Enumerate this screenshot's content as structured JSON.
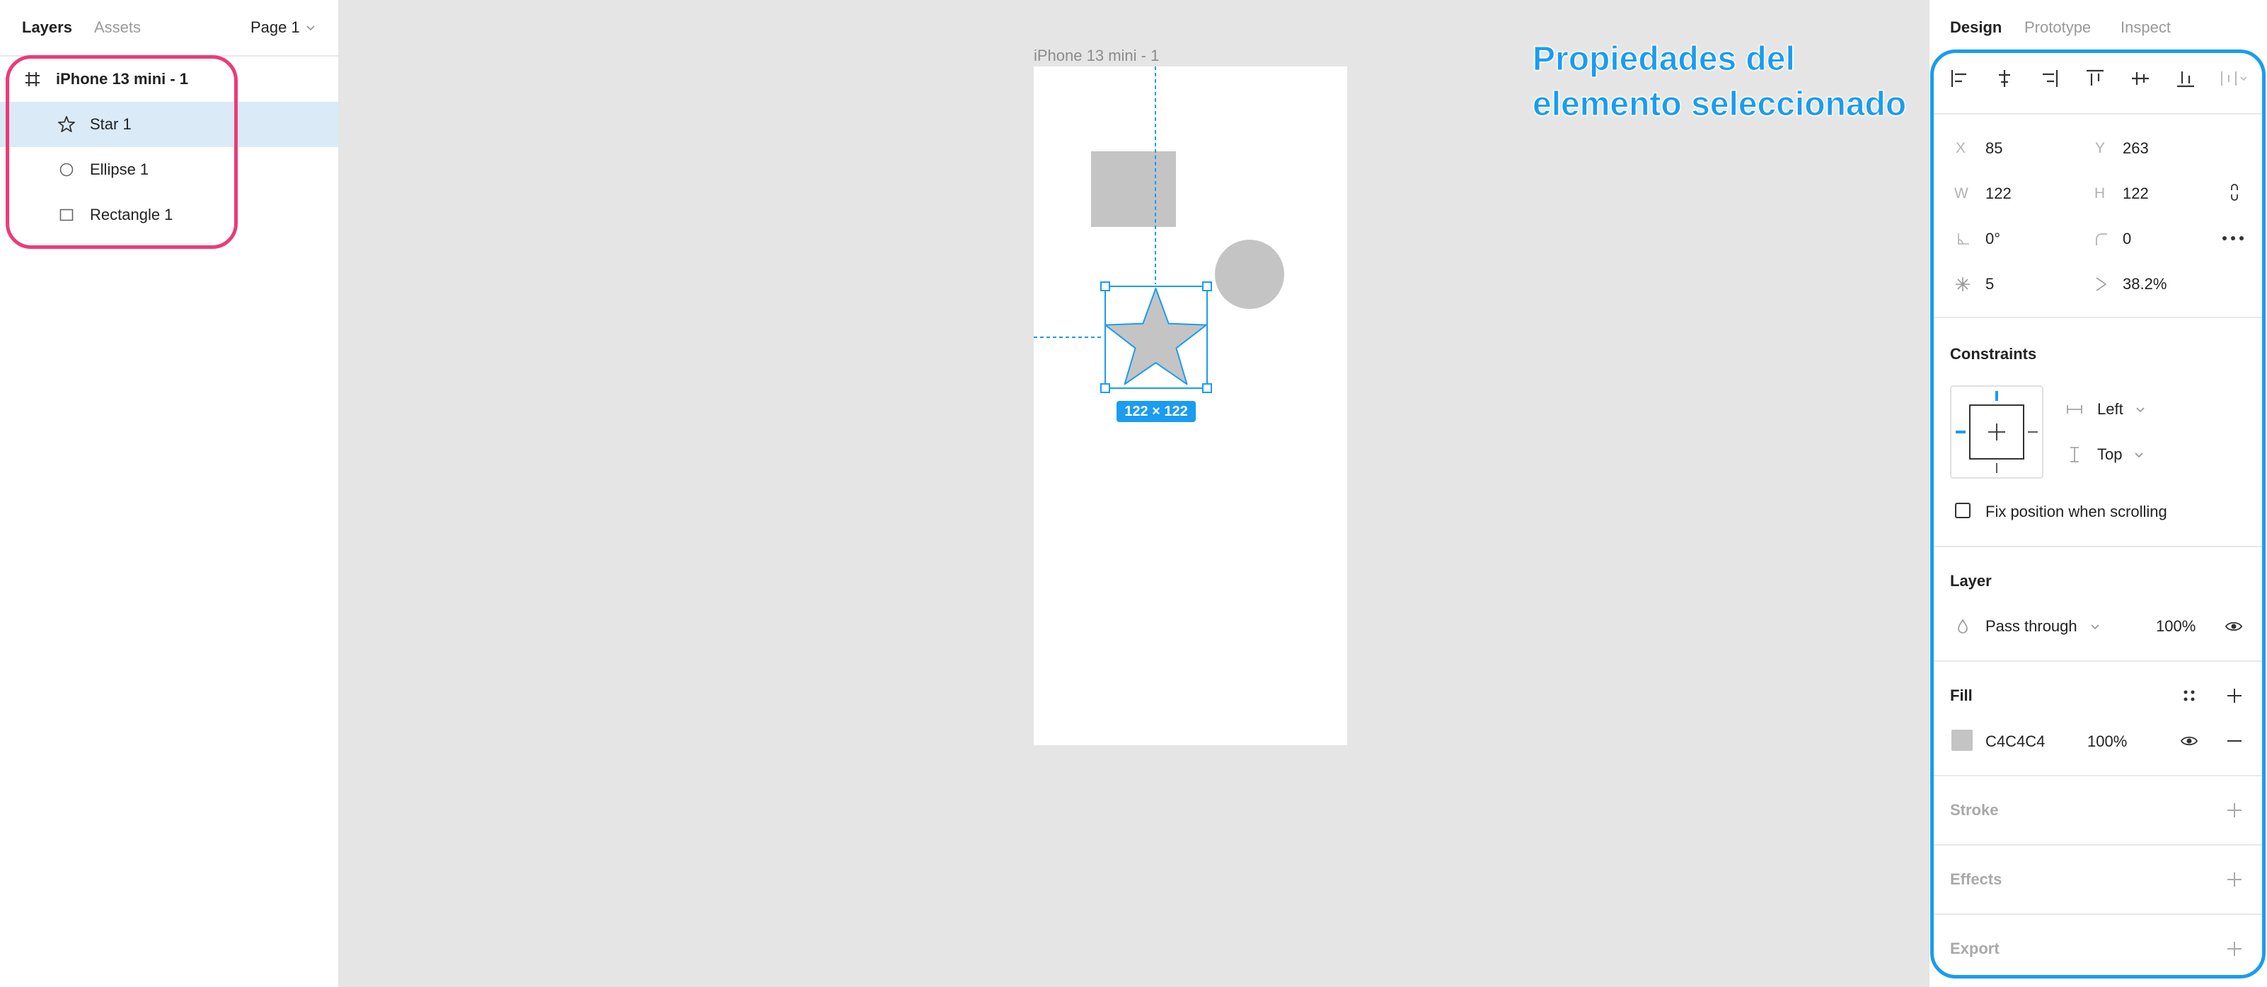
{
  "left_panel": {
    "tabs": [
      "Layers",
      "Assets"
    ],
    "page_selector": "Page 1",
    "layers": [
      {
        "name": "iPhone 13 mini - 1",
        "icon": "frame-icon",
        "bold": true
      },
      {
        "name": "Star 1",
        "icon": "star-icon",
        "selected": true
      },
      {
        "name": "Ellipse 1",
        "icon": "ellipse-icon"
      },
      {
        "name": "Rectangle 1",
        "icon": "rectangle-icon"
      }
    ]
  },
  "canvas": {
    "frame_label": "iPhone 13 mini - 1",
    "selection_size": "122 × 122",
    "annotation": "Propiedades del elemento seleccionado",
    "shape_fill": "#C4C4C4",
    "selection_color": "#1A9CF0"
  },
  "right_panel": {
    "tabs": [
      "Design",
      "Prototype",
      "Inspect"
    ],
    "x": {
      "label": "X",
      "value": "85"
    },
    "y": {
      "label": "Y",
      "value": "263"
    },
    "w": {
      "label": "W",
      "value": "122"
    },
    "h": {
      "label": "H",
      "value": "122"
    },
    "rotation": "0°",
    "corner_radius": "0",
    "points": "5",
    "ratio": "38.2%",
    "constraints": {
      "title": "Constraints",
      "horizontal": "Left",
      "vertical": "Top",
      "fix_position_label": "Fix position when scrolling",
      "fix_position": false
    },
    "layer": {
      "title": "Layer",
      "blend": "Pass through",
      "opacity": "100%"
    },
    "fill": {
      "title": "Fill",
      "hex": "C4C4C4",
      "opacity": "100%",
      "color": "#C4C4C4"
    },
    "stroke": {
      "title": "Stroke"
    },
    "effects": {
      "title": "Effects"
    },
    "export": {
      "title": "Export"
    }
  },
  "colors": {
    "accent": "#1A9CF0",
    "highlight_pink": "#EC3B77",
    "selection_row": "#DAEAF7"
  }
}
